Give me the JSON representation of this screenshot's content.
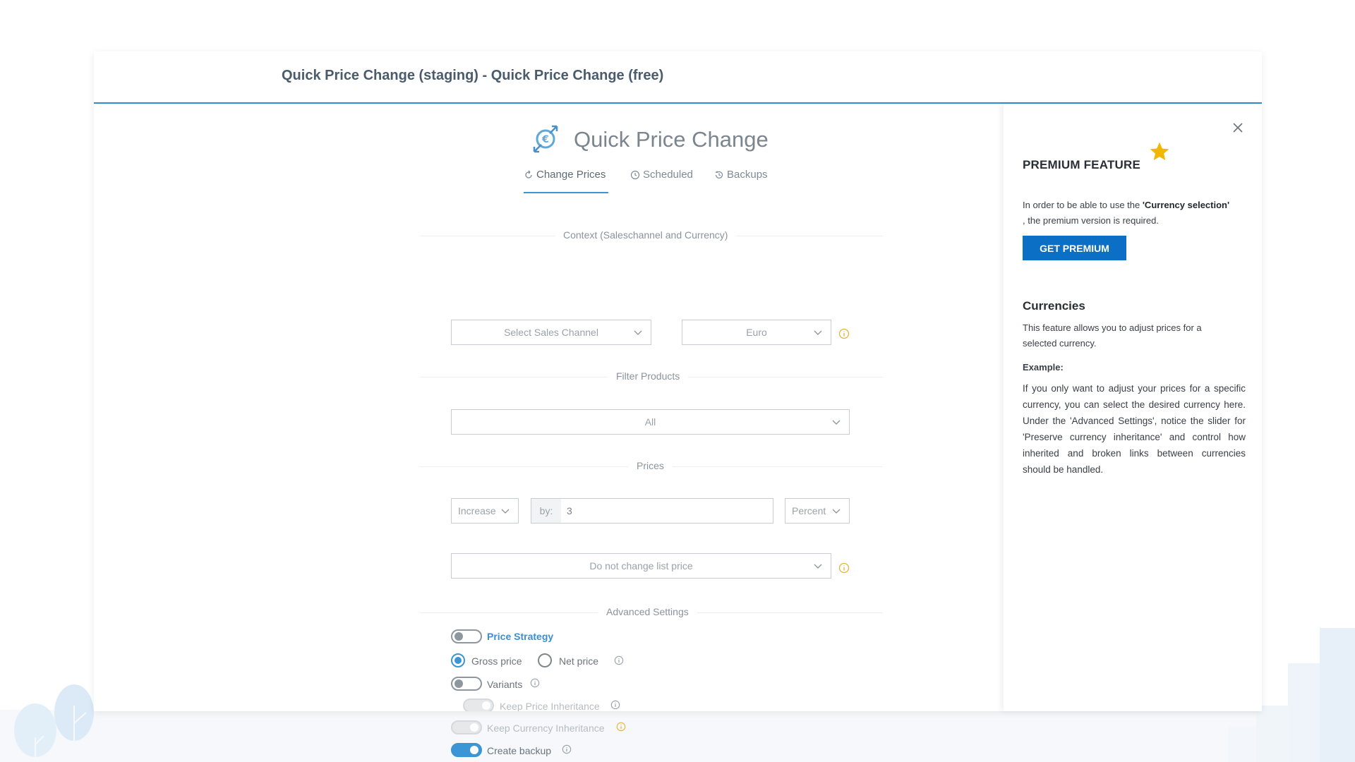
{
  "window": {
    "title": "Quick Price Change (staging) - Quick Price Change (free)"
  },
  "app": {
    "title": "Quick Price Change",
    "logo_icon": "price-change-logo-icon"
  },
  "tabs": [
    {
      "label": "Change Prices",
      "icon": "refresh-icon",
      "active": true
    },
    {
      "label": "Scheduled",
      "icon": "clock-icon",
      "active": false
    },
    {
      "label": "Backups",
      "icon": "history-icon",
      "active": false
    }
  ],
  "sections": {
    "context": "Context (Saleschannel and Currency)",
    "filter": "Filter Products",
    "prices": "Prices",
    "advanced": "Advanced Settings"
  },
  "context": {
    "sales_channel_placeholder": "Select Sales Channel",
    "currency": "Euro"
  },
  "filter": {
    "value": "All"
  },
  "prices": {
    "direction": "Increase",
    "by_prefix": "by:",
    "amount": "3",
    "unit": "Percent",
    "list_price": "Do not change list price"
  },
  "advanced": {
    "price_strategy": {
      "label": "Price Strategy",
      "enabled": false
    },
    "gross_price": {
      "label": "Gross price",
      "checked": true
    },
    "net_price": {
      "label": "Net price",
      "checked": false
    },
    "variants": {
      "label": "Variants",
      "enabled": false
    },
    "keep_price_inheritance": {
      "label": "Keep Price Inheritance",
      "disabled": true
    },
    "keep_currency_inheritance": {
      "label": "Keep Currency Inheritance",
      "disabled": true
    },
    "create_backup": {
      "label": "Create backup",
      "enabled": true
    }
  },
  "panel": {
    "title": "PREMIUM FEATURE",
    "desc_prefix": "In order to be able to use the ",
    "desc_feature": "'Currency selection'",
    "desc_suffix": " , the premium version is required.",
    "button": "GET PREMIUM",
    "section_title": "Currencies",
    "section_desc": "This feature allows you to adjust prices for a selected currency.",
    "example_label": "Example:",
    "example_text": "If you only want to adjust your prices for a specific currency, you can select the desired currency here. Under the 'Advanced Settings', notice the slider for 'Preserve currency inheritance' and control how inherited and broken links between currencies should be handled."
  },
  "colors": {
    "accent": "#3c95d4",
    "premium_button": "#0b6fc6",
    "star": "#f2b705",
    "warning_info": "#e8b339"
  }
}
